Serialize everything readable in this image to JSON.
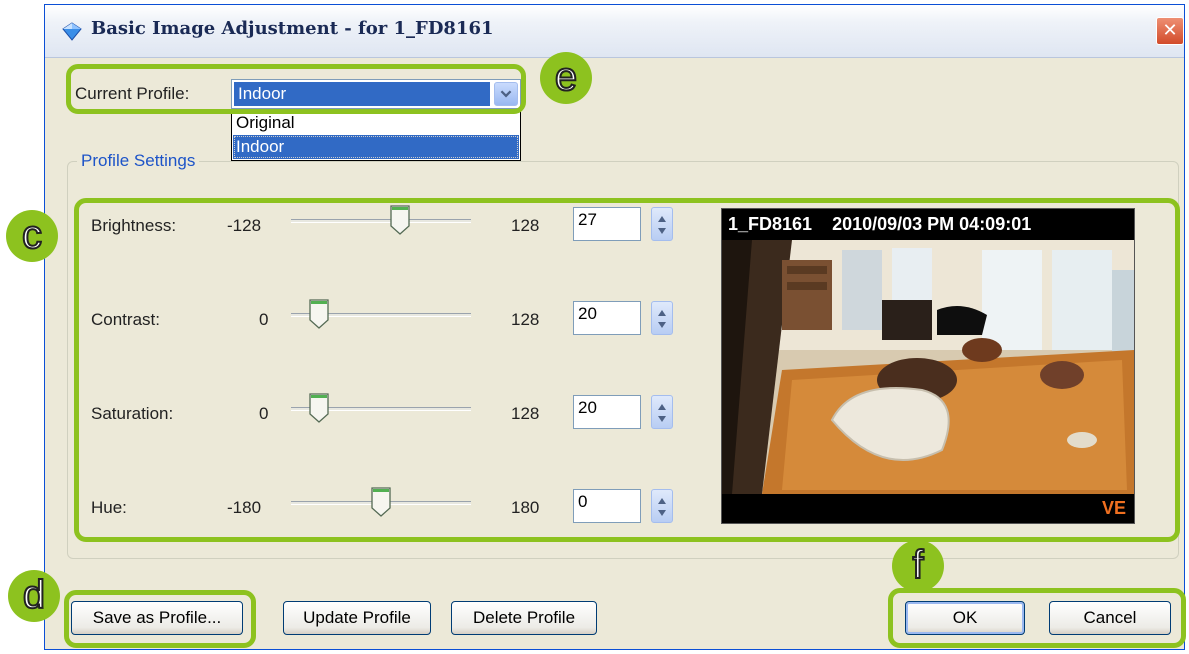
{
  "window": {
    "title": "Basic Image Adjustment - for 1_FD8161",
    "close_symbol": "✕"
  },
  "profile": {
    "label": "Current Profile:",
    "selected": "Indoor",
    "options": [
      "Original",
      "Indoor"
    ]
  },
  "settings": {
    "group_label": "Profile Settings",
    "sliders": [
      {
        "label": "Brightness:",
        "min": "-128",
        "max": "128",
        "value": "27",
        "fraction": 0.605
      },
      {
        "label": "Contrast:",
        "min": "0",
        "max": "128",
        "value": "20",
        "fraction": 0.156
      },
      {
        "label": "Saturation:",
        "min": "0",
        "max": "128",
        "value": "20",
        "fraction": 0.156
      },
      {
        "label": "Hue:",
        "min": "-180",
        "max": "180",
        "value": "0",
        "fraction": 0.5
      }
    ]
  },
  "preview": {
    "camera_name": "1_FD8161",
    "timestamp": "2010/09/03 PM 04:09:01",
    "logo": "VE"
  },
  "buttons": {
    "save_as": "Save as Profile...",
    "update": "Update Profile",
    "delete": "Delete Profile",
    "ok": "OK",
    "cancel": "Cancel"
  },
  "callouts": {
    "c": "c",
    "d": "d",
    "e": "e",
    "f": "f"
  },
  "colors": {
    "callout": "#8dc21f",
    "selection": "#316ac5",
    "group_label": "#1d54c8",
    "logo": "#f07020"
  },
  "icons": [
    "diamond-app-icon",
    "close-icon",
    "chevron-down-icon",
    "spin-up-icon",
    "spin-down-icon"
  ]
}
